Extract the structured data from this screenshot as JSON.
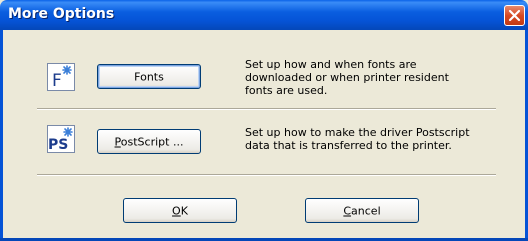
{
  "window": {
    "title": "More Options",
    "title_bar_color": "#0553d6",
    "close_icon": "close-icon"
  },
  "options": [
    {
      "icon_text": "F",
      "button_label": "Fonts",
      "description_lines": [
        "Set up how and when fonts are",
        "downloaded or when printer resident",
        "fonts are used."
      ]
    },
    {
      "icon_text": "PS",
      "button_label_prefix": "P",
      "button_label_rest": "ostScript ...",
      "description_lines": [
        "Set up how to make the driver Postscript",
        "data that is transferred to the printer."
      ]
    }
  ],
  "footer": {
    "ok_prefix": "O",
    "ok_rest": "K",
    "cancel_prefix": "C",
    "cancel_rest": "ancel"
  }
}
